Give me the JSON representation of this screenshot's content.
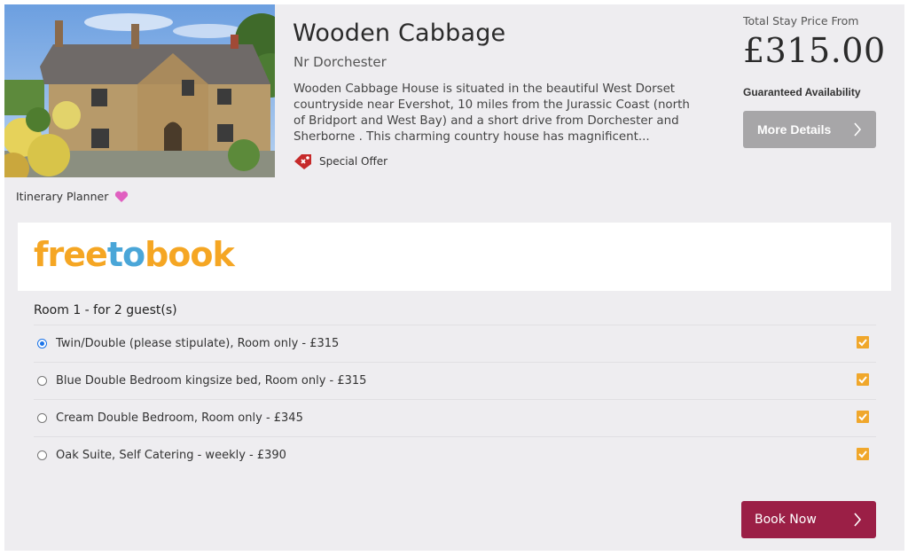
{
  "property": {
    "name": "Wooden Cabbage",
    "location": "Nr Dorchester",
    "description": "Wooden Cabbage House is situated in the beautiful West Dorset countryside near Evershot, 10 miles from the Jurassic Coast (north of Bridport and West Bay) and a short drive from Dorchester and Sherborne . This charming country house has magnificent...",
    "special_offer_label": "Special Offer"
  },
  "pricing": {
    "caption": "Total Stay Price From",
    "price": "£315.00",
    "availability": "Guaranteed Availability",
    "more_details_label": "More Details"
  },
  "planner": {
    "label": "Itinerary Planner",
    "icon": "heart-icon",
    "icon_color": "#e060c0"
  },
  "booking": {
    "logo_parts": [
      "free",
      "to",
      "book"
    ],
    "room_heading": "Room 1 - for 2 guest(s)",
    "rates": [
      {
        "label": "Twin/Double (please stipulate), Room only - £315",
        "selected": true
      },
      {
        "label": "Blue Double Bedroom kingsize bed, Room only - £315",
        "selected": false
      },
      {
        "label": "Cream Double Bedroom, Room only - £345",
        "selected": false
      },
      {
        "label": "Oak Suite, Self Catering - weekly - £390",
        "selected": false
      }
    ],
    "book_now_label": "Book Now"
  },
  "colors": {
    "book_button": "#9b1f46",
    "more_details_button": "#a7a6a8",
    "logo_orange": "#f5a623",
    "logo_blue": "#4aa6d8",
    "checkbox": "#f0a72b",
    "card_background": "#eeedf0"
  }
}
